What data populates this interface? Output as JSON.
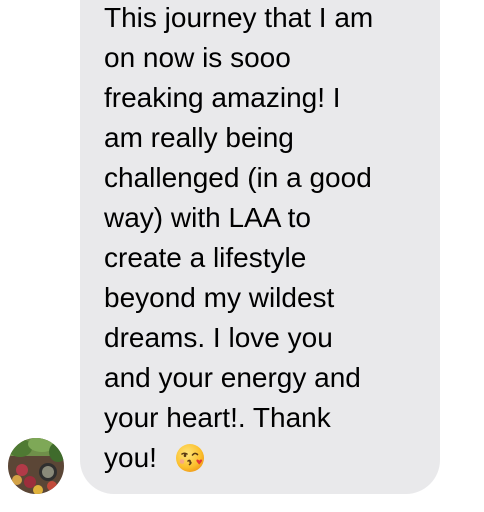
{
  "message": {
    "lines": [
      "This journey that I am",
      "on now is sooo",
      "freaking amazing!  I",
      "am really being",
      "challenged (in a good",
      "way) with LAA to",
      "create a lifestyle",
      "beyond my wildest",
      "dreams.   I love you",
      "and your  energy  and",
      "your heart!.  Thank",
      "you!"
    ],
    "emoji": "face-blowing-a-kiss-icon"
  },
  "colors": {
    "bubble": "#e9e9eb",
    "text": "#000000",
    "background": "#ffffff"
  },
  "sender": {
    "avatar": "avatar-photo"
  }
}
